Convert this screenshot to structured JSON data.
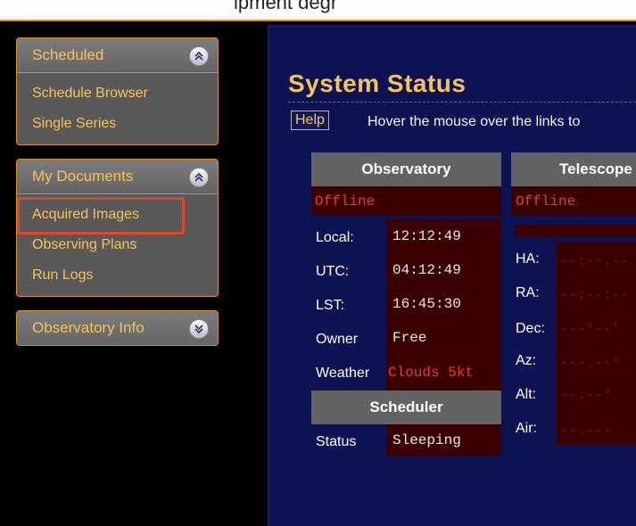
{
  "top_fragment": "ipment degr",
  "sidebar": {
    "panels": [
      {
        "title": "Scheduled",
        "items": [
          "Schedule Browser",
          "Single Series"
        ],
        "state": "expanded"
      },
      {
        "title": "My Documents",
        "items": [
          "Acquired Images",
          "Observing Plans",
          "Run Logs"
        ],
        "state": "expanded"
      },
      {
        "title": "Observatory Info",
        "items": [],
        "state": "collapsed"
      }
    ]
  },
  "main": {
    "title": "System Status",
    "help_label": "Help",
    "help_text": "Hover the mouse over the links to"
  },
  "observatory": {
    "header": "Observatory",
    "status": "Offline",
    "rows": [
      {
        "label": "Local:",
        "value": "12:12:49"
      },
      {
        "label": "UTC:",
        "value": "04:12:49"
      },
      {
        "label": "LST:",
        "value": "16:45:30"
      },
      {
        "label": "Owner",
        "value": "Free"
      },
      {
        "label": "Weather",
        "value": "Clouds 5kt"
      }
    ]
  },
  "scheduler": {
    "header": "Scheduler",
    "rows": [
      {
        "label": "Status",
        "value": "Sleeping"
      }
    ]
  },
  "telescope": {
    "header": "Telescope",
    "status": "Offline",
    "rows": [
      {
        "label": "HA:",
        "value": "--:--.--"
      },
      {
        "label": "RA:",
        "value": "--:--:--"
      },
      {
        "label": "Dec:",
        "value": "---°--'"
      },
      {
        "label": "Az:",
        "value": "---.--°"
      },
      {
        "label": "Alt:",
        "value": "--.--°"
      },
      {
        "label": "Air:",
        "value": "--.---"
      }
    ]
  },
  "colors": {
    "accent": "#f6c25a",
    "panel_bg": "#0c1252",
    "alert": "#e4402b",
    "highlight": "#e0452a"
  }
}
